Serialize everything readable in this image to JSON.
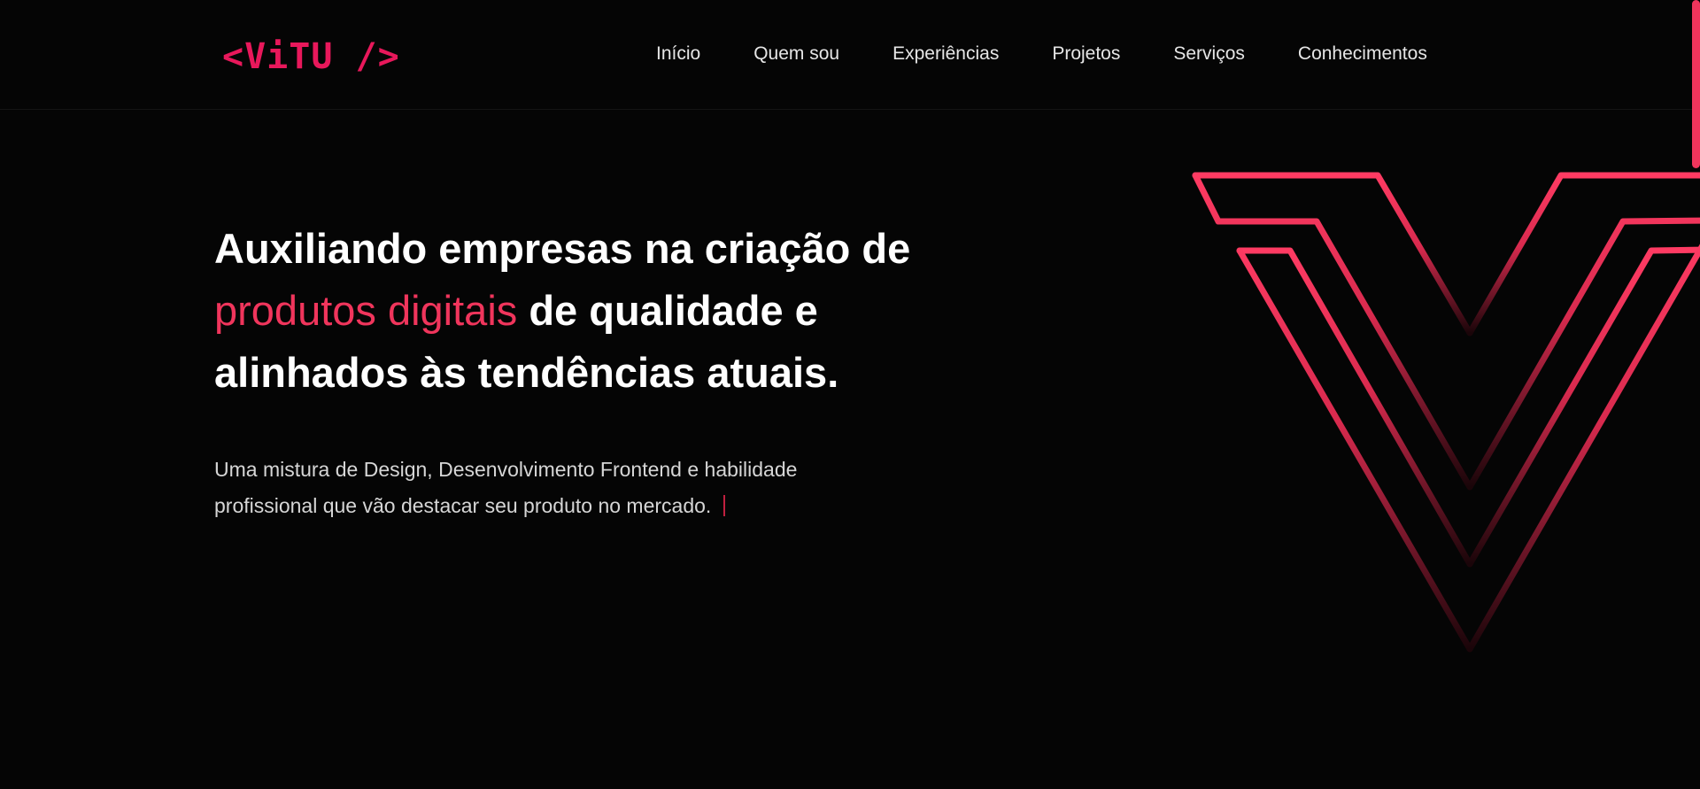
{
  "header": {
    "logo": "<ViTU />",
    "nav": [
      {
        "label": "Início"
      },
      {
        "label": "Quem sou"
      },
      {
        "label": "Experiências"
      },
      {
        "label": "Projetos"
      },
      {
        "label": "Serviços"
      },
      {
        "label": "Conhecimentos"
      }
    ]
  },
  "hero": {
    "title_part1": "Auxiliando empresas na criação de ",
    "title_accent": "produtos digitais",
    "title_part2": " de qualidade e alinhados às tendências atuais.",
    "subtitle": "Uma mistura de Design, Desenvolvimento Frontend e habilidade profissional que vão destacar seu produto no mercado."
  },
  "colors": {
    "accent": "#f0355c",
    "logo": "#e8185b",
    "background": "#050505"
  },
  "icons": {
    "decoration": "v-logo-lines-icon"
  }
}
